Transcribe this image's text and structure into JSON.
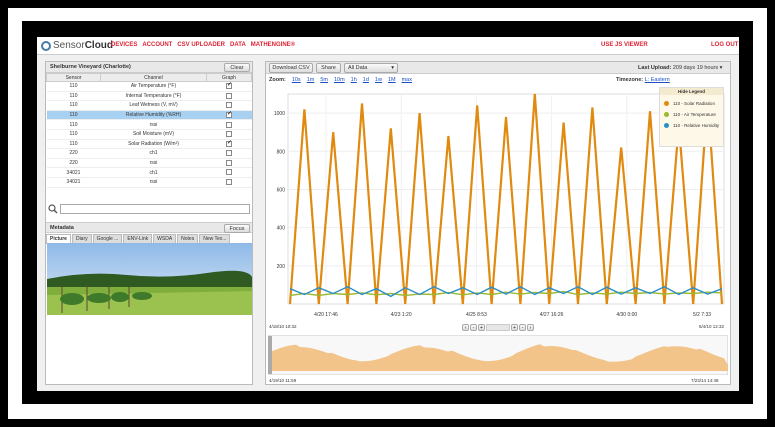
{
  "app": {
    "logo_text": "Sensor",
    "logo_bold": "Cloud",
    "nav": [
      "DEVICES",
      "ACCOUNT",
      "CSV UPLOADER",
      "DATA",
      "MATHENGINE®"
    ],
    "js_viewer": "USE JS VIEWER",
    "logout": "LOG OUT"
  },
  "sensors_panel": {
    "title": "Shelburne Vineyard (Charlotte)",
    "clear_label": "Clear",
    "columns": [
      "Sensor",
      "Channel",
      "Graph"
    ],
    "rows": [
      {
        "sensor": "110",
        "channel": "Air Temperature (°F)",
        "checked": true,
        "selected": false
      },
      {
        "sensor": "110",
        "channel": "Internal Temperature (°F)",
        "checked": false,
        "selected": false
      },
      {
        "sensor": "110",
        "channel": "Leaf Wetness (V, mV)",
        "checked": false,
        "selected": false
      },
      {
        "sensor": "110",
        "channel": "Relative Humidity (%RH)",
        "checked": true,
        "selected": true
      },
      {
        "sensor": "110",
        "channel": "rssi",
        "checked": false,
        "selected": false
      },
      {
        "sensor": "110",
        "channel": "Soil Moisture (mV)",
        "checked": false,
        "selected": false
      },
      {
        "sensor": "110",
        "channel": "Solar Radiation (W/m²)",
        "checked": true,
        "selected": false
      },
      {
        "sensor": "220",
        "channel": "ch1",
        "checked": false,
        "selected": false
      },
      {
        "sensor": "220",
        "channel": "rssi",
        "checked": false,
        "selected": false
      },
      {
        "sensor": "34021",
        "channel": "ch1",
        "checked": false,
        "selected": false
      },
      {
        "sensor": "34021",
        "channel": "rssi",
        "checked": false,
        "selected": false
      }
    ],
    "search_placeholder": ""
  },
  "metadata": {
    "title": "Metadata",
    "focus_label": "Focus",
    "tabs": [
      "Picture",
      "Diary",
      "Google ...",
      "ENV-Link",
      "WSDA",
      "Notes",
      "New Tex..."
    ],
    "active_tab": "Picture"
  },
  "graph_panel": {
    "download_label": "Download CSV",
    "share_label": "Share",
    "filter_label": "All Data",
    "last_upload_label": "Last Upload:",
    "last_upload_value": "209 days 19 hours",
    "zoom_label": "Zoom:",
    "zoom_options": [
      "10s",
      "1m",
      "5m",
      "10m",
      "1h",
      "1d",
      "1w",
      "1M",
      "max"
    ],
    "timezone_label": "Timezone:",
    "timezone_value": "L: Eastern",
    "legend_title": "Hide Legend",
    "range_start": "4/18/10 10:32",
    "range_end": "5/4/10 12:32",
    "nav_start": "4/19/10 11:59",
    "nav_end": "7/23/14 14:48",
    "colors": {
      "solar": "#e08a10",
      "air": "#9ab830",
      "humidity": "#2a8fc8"
    }
  },
  "chart_data": {
    "type": "line",
    "x_tick_labels": [
      "4/20 17:46",
      "4/23 1:20",
      "4/25 8:53",
      "4/27 16:26",
      "4/30 0:00",
      "5/2 7:33"
    ],
    "y_tick_labels": [
      "200",
      "400",
      "600",
      "800",
      "1000"
    ],
    "ylim": [
      0,
      1100
    ],
    "grid": true,
    "legend_placement": "top-right",
    "series": [
      {
        "name": "110 - Solar Radiation",
        "values": [
          0,
          1020,
          0,
          900,
          0,
          1050,
          0,
          920,
          0,
          1000,
          0,
          880,
          0,
          1040,
          0,
          980,
          0,
          1100,
          0,
          950,
          0,
          1030,
          0,
          820,
          0,
          1010,
          0,
          940,
          0,
          1080,
          0
        ]
      },
      {
        "name": "110 - Air Temperature",
        "values": [
          45,
          55,
          45,
          55,
          50,
          58,
          48,
          55,
          45,
          52,
          50,
          60,
          48,
          58,
          50,
          62,
          52,
          60,
          55,
          65,
          50,
          58,
          52,
          62,
          55,
          60,
          52,
          58,
          55,
          62,
          58
        ]
      },
      {
        "name": "110 - Relative Humidity",
        "values": [
          80,
          50,
          85,
          55,
          90,
          50,
          80,
          40,
          85,
          50,
          90,
          55,
          85,
          50,
          88,
          52,
          90,
          50,
          85,
          55,
          90,
          50,
          88,
          52,
          85,
          55,
          90,
          50,
          85,
          52,
          80
        ]
      }
    ]
  }
}
